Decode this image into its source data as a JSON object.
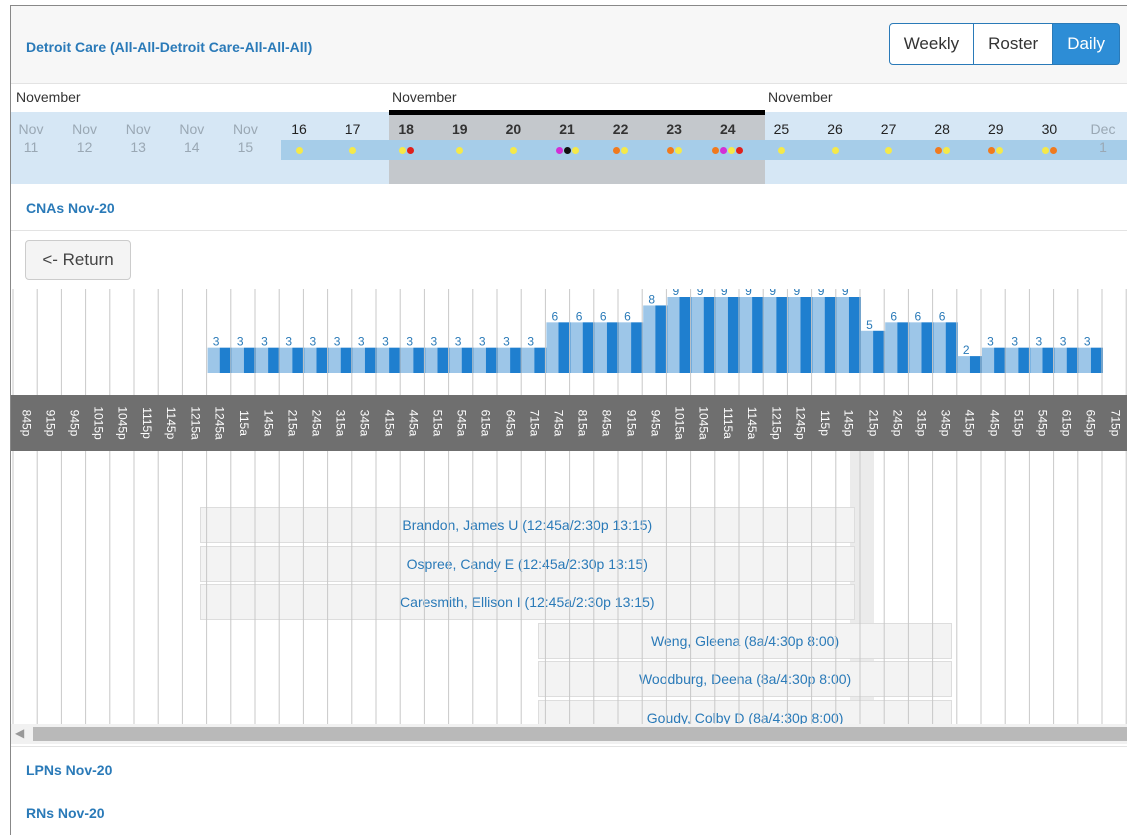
{
  "header": {
    "title": "Detroit Care (All-All-Detroit Care-All-All-All)",
    "views": [
      {
        "label": "Weekly",
        "active": false
      },
      {
        "label": "Roster",
        "active": false
      },
      {
        "label": "Daily",
        "active": true
      }
    ]
  },
  "months": [
    "November",
    "November",
    "November"
  ],
  "days": [
    {
      "top": "Nov",
      "bottom": "11",
      "state": "past",
      "dots": []
    },
    {
      "top": "Nov",
      "bottom": "12",
      "state": "past",
      "dots": []
    },
    {
      "top": "Nov",
      "bottom": "13",
      "state": "past",
      "dots": []
    },
    {
      "top": "Nov",
      "bottom": "14",
      "state": "past",
      "dots": []
    },
    {
      "top": "Nov",
      "bottom": "15",
      "state": "past",
      "dots": []
    },
    {
      "top": "16",
      "bottom": "",
      "state": "cur",
      "dots": [
        "#f5e94a"
      ]
    },
    {
      "top": "17",
      "bottom": "",
      "state": "cur",
      "dots": [
        "#f5e94a"
      ]
    },
    {
      "top": "18",
      "bottom": "",
      "state": "week",
      "dots": [
        "#f5e94a",
        "#e0201c"
      ]
    },
    {
      "top": "19",
      "bottom": "",
      "state": "week",
      "dots": [
        "#f5e94a"
      ]
    },
    {
      "top": "20",
      "bottom": "",
      "state": "week",
      "dots": [
        "#f5e94a"
      ]
    },
    {
      "top": "21",
      "bottom": "",
      "state": "week",
      "dots": [
        "#d22fd6",
        "#111111",
        "#f5e94a"
      ]
    },
    {
      "top": "22",
      "bottom": "",
      "state": "week",
      "dots": [
        "#f07a1e",
        "#f5e94a"
      ]
    },
    {
      "top": "23",
      "bottom": "",
      "state": "week",
      "dots": [
        "#f07a1e",
        "#f5e94a"
      ]
    },
    {
      "top": "24",
      "bottom": "",
      "state": "week",
      "dots": [
        "#f07a1e",
        "#d22fd6",
        "#f5e94a",
        "#e0201c"
      ]
    },
    {
      "top": "25",
      "bottom": "",
      "state": "cur",
      "dots": [
        "#f5e94a"
      ]
    },
    {
      "top": "26",
      "bottom": "",
      "state": "cur",
      "dots": [
        "#f5e94a"
      ]
    },
    {
      "top": "27",
      "bottom": "",
      "state": "cur",
      "dots": [
        "#f5e94a"
      ]
    },
    {
      "top": "28",
      "bottom": "",
      "state": "cur",
      "dots": [
        "#f07a1e",
        "#f5e94a"
      ]
    },
    {
      "top": "29",
      "bottom": "",
      "state": "cur",
      "dots": [
        "#f07a1e",
        "#f5e94a"
      ]
    },
    {
      "top": "30",
      "bottom": "",
      "state": "cur",
      "dots": [
        "#f5e94a",
        "#f07a1e"
      ]
    },
    {
      "top": "Dec",
      "bottom": "1",
      "state": "past",
      "dots": []
    }
  ],
  "sections": {
    "cnas": "CNAs Nov-20",
    "lpns": "LPNs Nov-20",
    "rns": "RNs Nov-20"
  },
  "return_label": "<- Return",
  "chart_data": {
    "type": "bar",
    "categories": [
      "845p",
      "915p",
      "945p",
      "1015p",
      "1045p",
      "1115p",
      "1145p",
      "1215a",
      "1245a",
      "115a",
      "145a",
      "215a",
      "245a",
      "315a",
      "345a",
      "415a",
      "445a",
      "515a",
      "545a",
      "615a",
      "645a",
      "715a",
      "745a",
      "815a",
      "845a",
      "915a",
      "945a",
      "1015a",
      "1045a",
      "1115a",
      "1145a",
      "1215p",
      "1245p",
      "115p",
      "145p",
      "215p",
      "245p",
      "315p",
      "345p",
      "415p",
      "445p",
      "515p",
      "545p",
      "615p",
      "645p",
      "715p"
    ],
    "values": [
      0,
      0,
      0,
      0,
      0,
      0,
      0,
      0,
      3,
      3,
      3,
      3,
      3,
      3,
      3,
      3,
      3,
      3,
      3,
      3,
      3,
      3,
      6,
      6,
      6,
      6,
      8,
      9,
      9,
      9,
      9,
      9,
      9,
      9,
      9,
      5,
      6,
      6,
      6,
      2,
      3,
      3,
      3,
      3,
      3,
      0
    ],
    "colors": {
      "light": "#9dc6e8",
      "dark": "#1f7fcf",
      "label": "#2a7ab8"
    }
  },
  "shifts": [
    {
      "label": "Brandon, James U (12:45a/2:30p 13:15)",
      "start": 8,
      "end": 35
    },
    {
      "label": "Ospree, Candy E (12:45a/2:30p 13:15)",
      "start": 8,
      "end": 35
    },
    {
      "label": "Caresmith, Ellison I (12:45a/2:30p 13:15)",
      "start": 8,
      "end": 35
    },
    {
      "label": "Weng, Gleena  (8a/4:30p 8:00)",
      "start": 22,
      "end": 39
    },
    {
      "label": "Woodburg, Deena  (8a/4:30p 8:00)",
      "start": 22,
      "end": 39
    },
    {
      "label": "Goudy, Colby D (8a/4:30p 8:00)",
      "start": 22,
      "end": 39
    }
  ]
}
